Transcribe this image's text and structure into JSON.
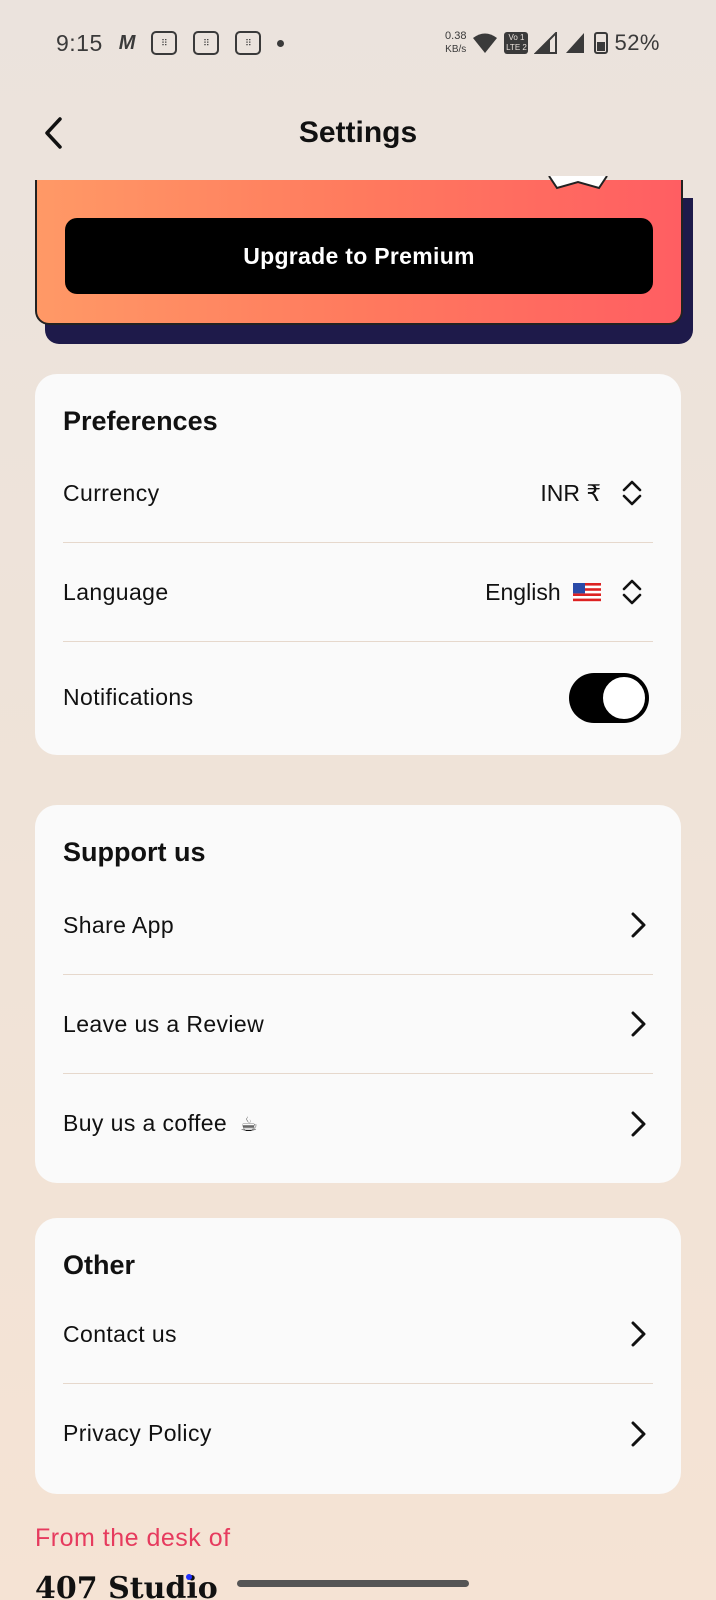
{
  "status_bar": {
    "time": "9:15",
    "net_speed_value": "0.38",
    "net_speed_unit": "KB/s",
    "volte_label": "Vo 1 LTE 2",
    "battery": "52%"
  },
  "header": {
    "title": "Settings"
  },
  "premium": {
    "button_label": "Upgrade to Premium"
  },
  "preferences": {
    "title": "Preferences",
    "currency_label": "Currency",
    "currency_value": "INR ₹",
    "language_label": "Language",
    "language_value": "English",
    "notifications_label": "Notifications",
    "notifications_on": true
  },
  "support": {
    "title": "Support us",
    "items": [
      {
        "label": "Share App"
      },
      {
        "label": "Leave us a Review"
      },
      {
        "label": "Buy us a coffee"
      }
    ],
    "coffee_emoji": "☕"
  },
  "other": {
    "title": "Other",
    "items": [
      {
        "label": "Contact us"
      },
      {
        "label": "Privacy Policy"
      }
    ]
  },
  "footer": {
    "desk_text": "From the desk of",
    "studio_name": "407 Studio"
  },
  "colors": {
    "accent_pink": "#e63b5e",
    "premium_gradient_start": "#ff9966",
    "premium_gradient_end": "#ff5e62"
  }
}
